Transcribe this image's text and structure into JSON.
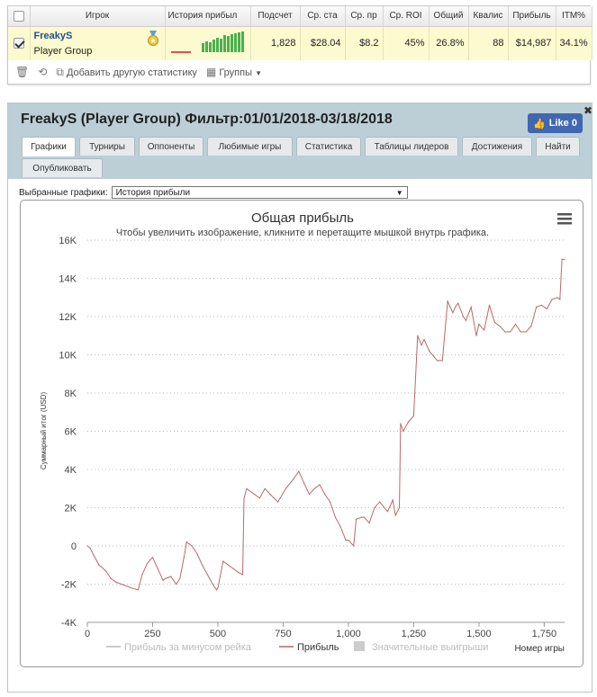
{
  "stats_table": {
    "headers": [
      "Игрок",
      "История прибыл",
      "Подсчет",
      "Ср. ста",
      "Ср. пр",
      "Ср. ROI",
      "Общий",
      "Квалис",
      "Прибыль",
      "ITM%"
    ],
    "row": {
      "player_name": "FreakyS",
      "player_group": "Player Group",
      "count": "1,828",
      "avg_stake": "$28.04",
      "avg_profit": "$8.2",
      "avg_roi": "45%",
      "total": "26.8%",
      "qualif": "88",
      "profit": "$14,987",
      "itm": "34.1%"
    }
  },
  "toolbar": {
    "add_stat": "Добавить другую статистику",
    "groups": "Группы"
  },
  "panel": {
    "title": "FreakyS (Player Group) Фильтр:01/01/2018-03/18/2018",
    "like_label": "Like 0",
    "tabs": [
      "Графики",
      "Турниры",
      "Оппоненты",
      "Любимые игры",
      "Статистика",
      "Таблицы лидеров",
      "Достижения",
      "Найти",
      "Опубликовать"
    ],
    "active_tab": "Графики",
    "select_label": "Выбранные графики:",
    "select_value": "История прибыли"
  },
  "chart_data": {
    "type": "line",
    "title": "Общая прибыль",
    "subtitle": "Чтобы увеличить изображение, кликните и перетащите мышкой внутрь графика.",
    "xlabel": "Номер игры",
    "ylabel": "Суммарный итог (USD)",
    "xlim": [
      0,
      1828
    ],
    "ylim": [
      -4000,
      16000
    ],
    "x_ticks": [
      0,
      250,
      500,
      750,
      1000,
      1250,
      1500,
      1750
    ],
    "x_tick_labels": [
      "0",
      "250",
      "500",
      "750",
      "1,000",
      "1,250",
      "1,500",
      "1,750"
    ],
    "y_ticks": [
      -4000,
      -2000,
      0,
      2000,
      4000,
      6000,
      8000,
      10000,
      12000,
      14000,
      16000
    ],
    "y_tick_labels": [
      "-4K",
      "-2K",
      "0",
      "2K",
      "4K",
      "6K",
      "8K",
      "10K",
      "12K",
      "14K",
      "16K"
    ],
    "grid": "horizontal dotted",
    "legend_position": "bottom",
    "legend": [
      {
        "name": "Прибыль за минусом рейка",
        "color": "#cccccc",
        "kind": "line",
        "enabled": false
      },
      {
        "name": "Прибыль",
        "color": "#c98a8a",
        "kind": "line",
        "enabled": true
      },
      {
        "name": "Значительные выигрыши",
        "color": "#cccccc",
        "kind": "box",
        "enabled": false
      }
    ],
    "series": [
      {
        "name": "Прибыль",
        "color": "#b86a6a",
        "x": [
          0,
          10,
          25,
          45,
          70,
          90,
          110,
          130,
          150,
          170,
          195,
          210,
          230,
          250,
          270,
          290,
          300,
          320,
          340,
          355,
          370,
          380,
          400,
          420,
          440,
          460,
          480,
          495,
          500,
          520,
          540,
          560,
          580,
          595,
          600,
          610,
          640,
          660,
          680,
          700,
          730,
          760,
          790,
          810,
          830,
          850,
          870,
          890,
          910,
          930,
          950,
          970,
          990,
          1000,
          1020,
          1030,
          1050,
          1060,
          1080,
          1100,
          1120,
          1150,
          1170,
          1180,
          1195,
          1200,
          1210,
          1230,
          1250,
          1265,
          1280,
          1290,
          1310,
          1340,
          1360,
          1380,
          1400,
          1410,
          1420,
          1440,
          1450,
          1470,
          1490,
          1500,
          1520,
          1540,
          1560,
          1580,
          1600,
          1620,
          1640,
          1660,
          1680,
          1700,
          1720,
          1740,
          1760,
          1780,
          1800,
          1810,
          1818,
          1828
        ],
        "y": [
          0,
          -100,
          -500,
          -1000,
          -1300,
          -1700,
          -1900,
          -2000,
          -2100,
          -2200,
          -2300,
          -1500,
          -900,
          -600,
          -1200,
          -1800,
          -1700,
          -1600,
          -2000,
          -1700,
          -600,
          200,
          0,
          -400,
          -1000,
          -1500,
          -2000,
          -2300,
          -2200,
          -800,
          -1000,
          -1200,
          -1400,
          -1500,
          2500,
          3000,
          2700,
          2500,
          3000,
          2700,
          2300,
          3000,
          3500,
          3900,
          3300,
          2700,
          3000,
          3200,
          2700,
          2300,
          1500,
          1000,
          300,
          300,
          0,
          1400,
          1500,
          1500,
          1200,
          2000,
          2300,
          1800,
          2400,
          1600,
          2000,
          6400,
          6000,
          6500,
          6800,
          11000,
          10500,
          10800,
          10200,
          9700,
          9700,
          12800,
          12200,
          12500,
          12700,
          12000,
          11800,
          12500,
          11000,
          11600,
          11300,
          12600,
          11700,
          11500,
          11200,
          11200,
          11600,
          11200,
          11200,
          11500,
          12500,
          12600,
          12400,
          12900,
          13000,
          12900,
          15000,
          14987
        ]
      }
    ]
  }
}
